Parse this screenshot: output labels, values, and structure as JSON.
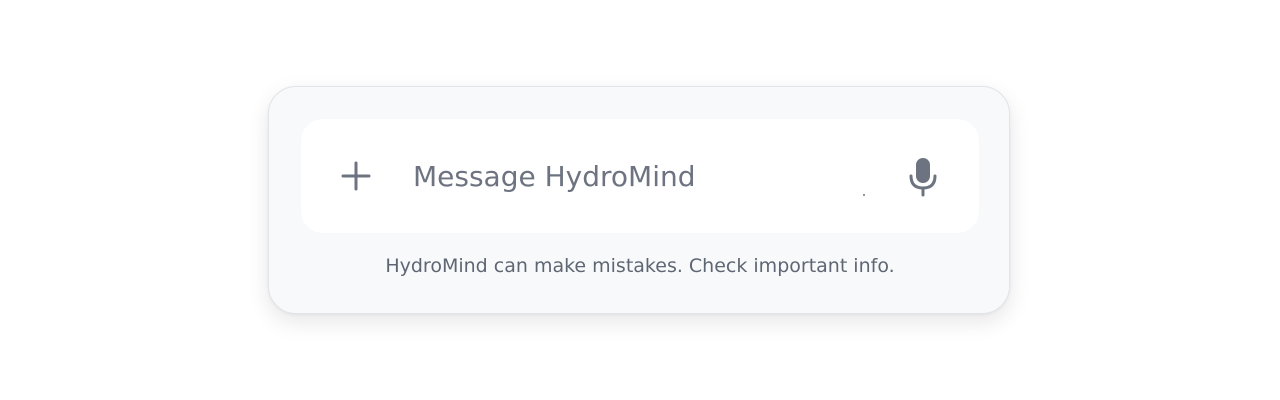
{
  "composer": {
    "placeholder": "Message HydroMind",
    "value": "",
    "disclaimer": "HydroMind can make mistakes. Check important info.",
    "icons": {
      "attach": "plus-icon",
      "voice": "microphone-icon"
    },
    "colors": {
      "icon": "#6d7380",
      "card_background": "#f8f9fb",
      "input_background": "#ffffff",
      "text_muted": "#5f6673"
    }
  }
}
